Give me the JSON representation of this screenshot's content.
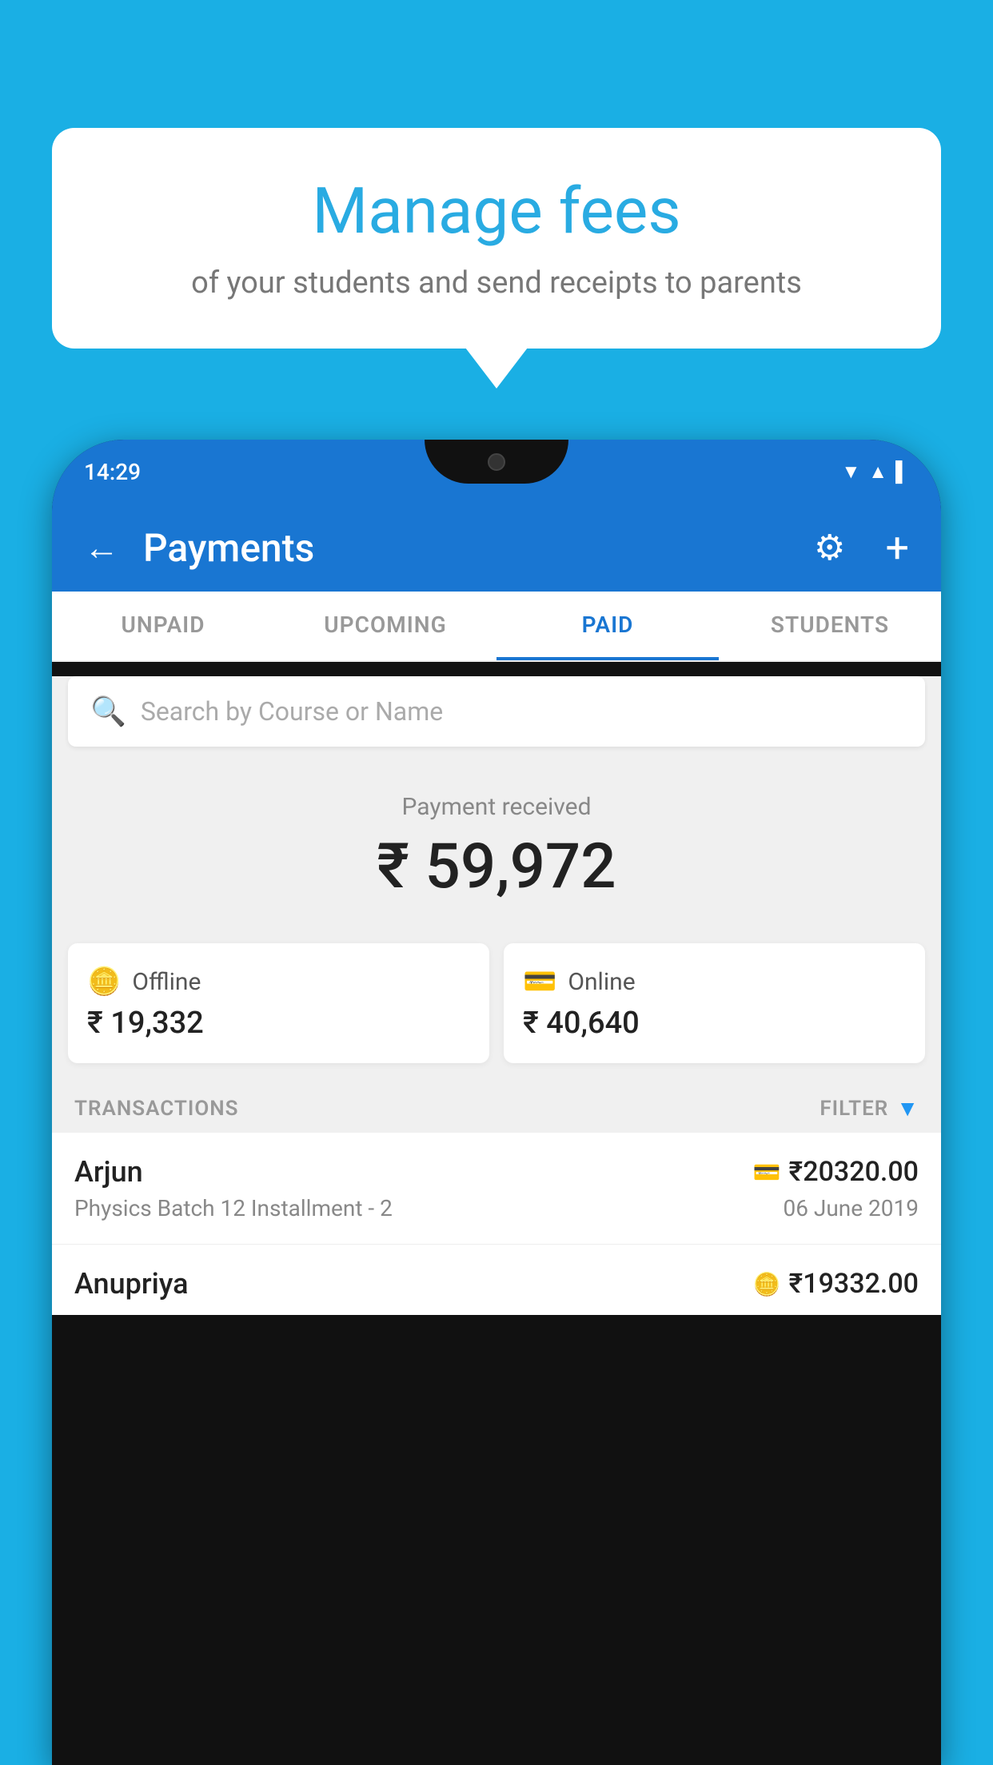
{
  "background_color": "#1AAFE4",
  "bubble": {
    "title": "Manage fees",
    "subtitle": "of your students and send receipts to parents"
  },
  "status_bar": {
    "time": "14:29",
    "icons": [
      "wifi",
      "signal",
      "battery"
    ]
  },
  "header": {
    "title": "Payments",
    "back_label": "←",
    "gear_label": "⚙",
    "plus_label": "+"
  },
  "tabs": [
    {
      "label": "UNPAID",
      "active": false
    },
    {
      "label": "UPCOMING",
      "active": false
    },
    {
      "label": "PAID",
      "active": true
    },
    {
      "label": "STUDENTS",
      "active": false
    }
  ],
  "search": {
    "placeholder": "Search by Course or Name"
  },
  "payment_received": {
    "label": "Payment received",
    "amount": "₹ 59,972"
  },
  "payment_cards": [
    {
      "type": "Offline",
      "amount": "₹ 19,332",
      "icon": "💳"
    },
    {
      "type": "Online",
      "amount": "₹ 40,640",
      "icon": "💳"
    }
  ],
  "transactions_section": {
    "label": "TRANSACTIONS",
    "filter_label": "FILTER"
  },
  "transactions": [
    {
      "name": "Arjun",
      "course": "Physics Batch 12 Installment - 2",
      "amount": "₹20320.00",
      "date": "06 June 2019",
      "type_icon": "card"
    },
    {
      "name": "Anupriya",
      "course": "",
      "amount": "₹19332.00",
      "date": "",
      "type_icon": "cash"
    }
  ]
}
